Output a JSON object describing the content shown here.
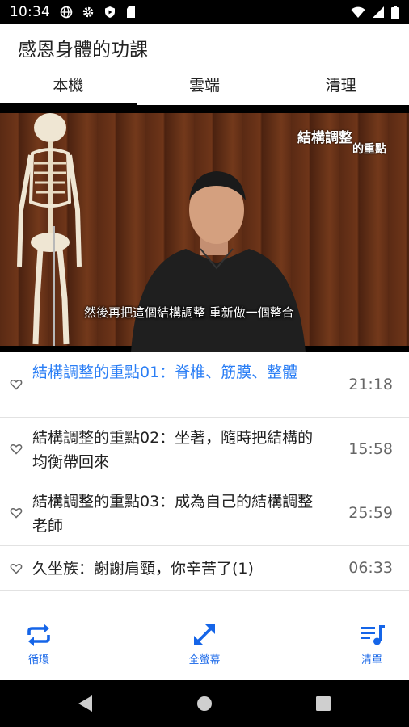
{
  "status": {
    "time": "10:34",
    "icons_left": [
      "globe-icon",
      "gear-icon",
      "shield-play-icon",
      "sd-card-icon"
    ],
    "icons_right": [
      "wifi-icon",
      "signal-icon",
      "battery-icon"
    ]
  },
  "app": {
    "title": "感恩身體的功課"
  },
  "tabs": [
    {
      "label": "本機",
      "active": true
    },
    {
      "label": "雲端",
      "active": false
    },
    {
      "label": "清理",
      "active": false
    }
  ],
  "video": {
    "caption_line1": "結構調整",
    "caption_line2": "的重點",
    "subtitle": "然後再把這個結構調整 重新做一個整合"
  },
  "playlist": [
    {
      "title": "結構調整的重點01：脊椎、筋膜、整體",
      "duration": "21:18",
      "playing": true
    },
    {
      "title": "結構調整的重點02：坐著，隨時把結構的均衡帶回來",
      "duration": "15:58",
      "playing": false
    },
    {
      "title": "結構調整的重點03：成為自己的結構調整老師",
      "duration": "25:59",
      "playing": false
    },
    {
      "title": "久坐族：謝謝肩頸，你辛苦了(1)",
      "duration": "06:33",
      "playing": false
    }
  ],
  "bottom": {
    "loop_label": "循環",
    "fullscreen_label": "全螢幕",
    "list_label": "清單"
  },
  "colors": {
    "accent": "#1565e8",
    "playing_text": "#2a7ef5"
  }
}
